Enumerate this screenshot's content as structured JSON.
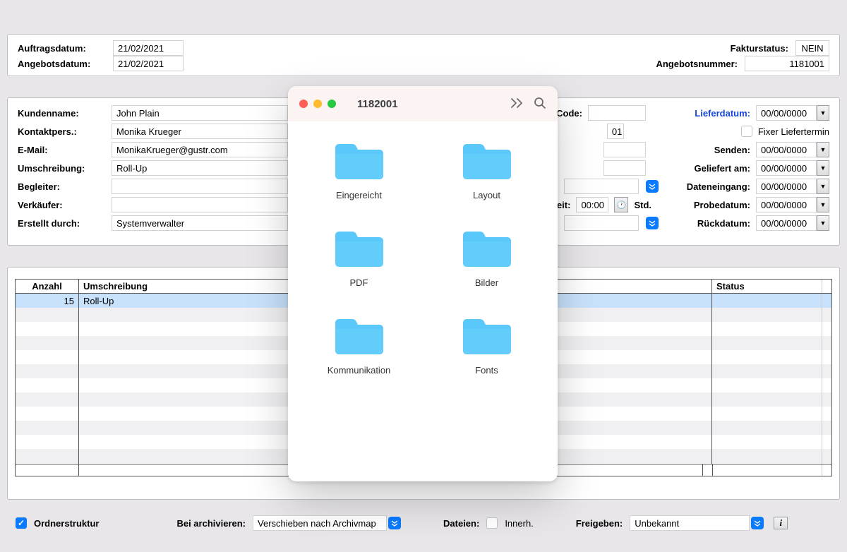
{
  "top": {
    "auftragsdatum_label": "Auftragsdatum:",
    "auftragsdatum": "21/02/2021",
    "angebotsdatum_label": "Angebotsdatum:",
    "angebotsdatum": "21/02/2021",
    "fakturstatus_label": "Fakturstatus:",
    "fakturstatus": "NEIN",
    "angebotsnummer_label": "Angebotsnummer:",
    "angebotsnummer": "1181001"
  },
  "mid": {
    "kundenname_label": "Kundenname:",
    "kundenname": "John Plain",
    "kontaktpers_label": "Kontaktpers.:",
    "kontaktpers": "Monika Krueger",
    "email_label": "E-Mail:",
    "email": "MonikaKrueger@gustr.com",
    "umschreibung_label": "Umschreibung:",
    "umschreibung": "Roll-Up",
    "begleiter_label": "Begleiter:",
    "begleiter": "",
    "verkaufer_label": "Verkäufer:",
    "verkaufer": "",
    "erstellt_label": "Erstellt durch:",
    "erstellt": "Systemverwalter",
    "code_label": "Code:",
    "code": "",
    "partial_01": "01",
    "lieferdatum_label": "Lieferdatum:",
    "lieferdatum": "00/00/0000",
    "fixer_label": "Fixer Liefertermin",
    "senden_label": "Senden:",
    "senden": "00/00/0000",
    "geliefert_label": "Geliefert am:",
    "geliefert": "00/00/0000",
    "dateneingang_label": "Dateneingang:",
    "dateneingang": "00/00/0000",
    "zeit_label": "Zeit:",
    "zeit": "00:00",
    "std_label": "Std.",
    "probedatum_label": "Probedatum:",
    "probedatum": "00/00/0000",
    "ruckdatum_label": "Rückdatum:",
    "ruckdatum": "00/00/0000"
  },
  "table": {
    "headers": {
      "anzahl": "Anzahl",
      "umschreibung": "Umschreibung",
      "status": "Status"
    },
    "rows": [
      {
        "anzahl": "15",
        "umschreibung": "Roll-Up",
        "status": ""
      }
    ]
  },
  "bottom": {
    "ordnerstruktur_label": "Ordnerstruktur",
    "archivieren_label": "Bei archivieren:",
    "archivieren_value": "Verschieben nach Archivmap",
    "dateien_label": "Dateien:",
    "innerh_label": "Innerh.",
    "freigeben_label": "Freigeben:",
    "freigeben_value": "Unbekannt"
  },
  "finder": {
    "title": "1182001",
    "folders": [
      "Eingereicht",
      "Layout",
      "PDF",
      "Bilder",
      "Kommunikation",
      "Fonts"
    ]
  }
}
